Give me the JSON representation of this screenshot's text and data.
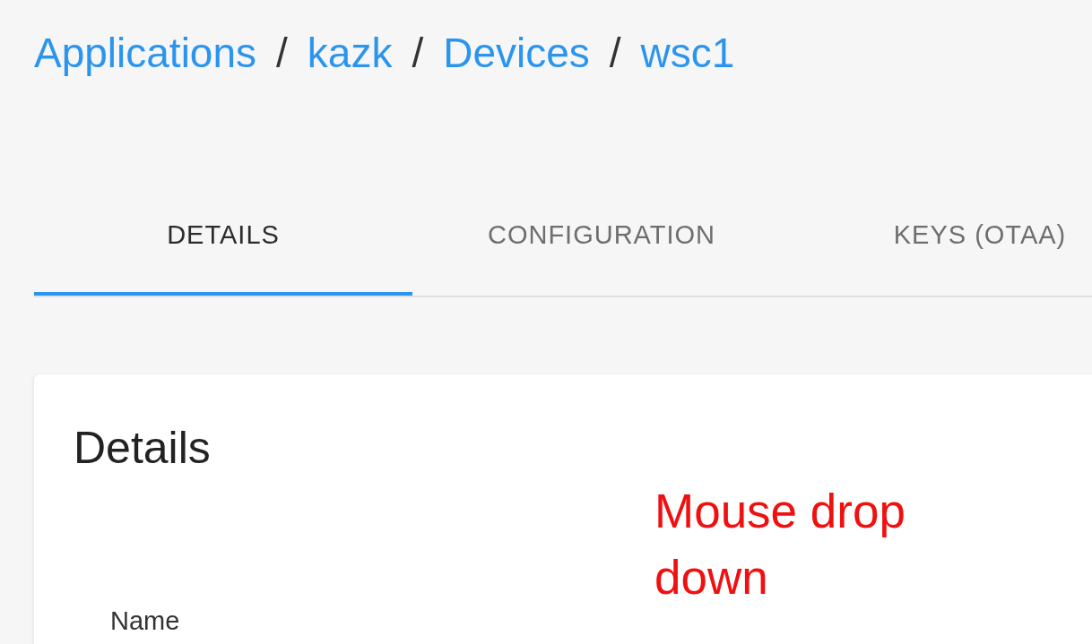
{
  "breadcrumb": [
    {
      "kind": "link",
      "text": "Applications"
    },
    {
      "kind": "separator",
      "text": "/"
    },
    {
      "kind": "link",
      "text": "kazk"
    },
    {
      "kind": "separator",
      "text": "/"
    },
    {
      "kind": "link",
      "text": "Devices"
    },
    {
      "kind": "separator",
      "text": "/"
    },
    {
      "kind": "link",
      "text": "wsc1"
    }
  ],
  "tabs": [
    {
      "label": "DETAILS",
      "selected": true
    },
    {
      "label": "CONFIGURATION",
      "selected": false
    },
    {
      "label": "KEYS (OTAA)",
      "selected": false
    }
  ],
  "card": {
    "title": "Details",
    "fields": [
      {
        "label": "Name"
      }
    ]
  },
  "annotation": "Mouse drop down"
}
